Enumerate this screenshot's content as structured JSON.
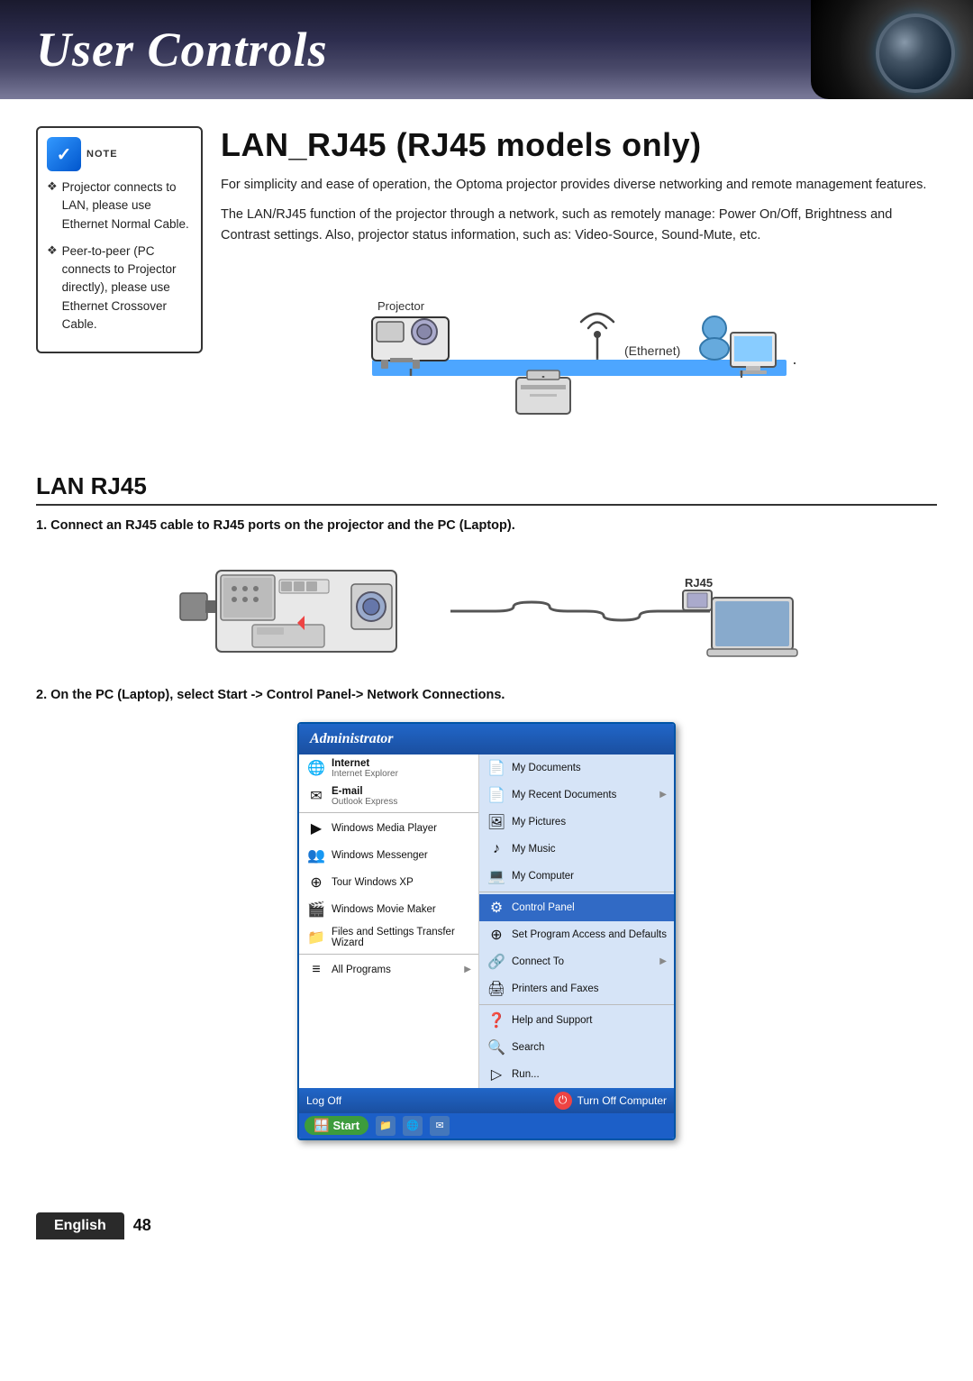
{
  "header": {
    "title": "User Controls",
    "lens_alt": "projector lens"
  },
  "page": {
    "section_title": "LAN_RJ45 (RJ45 models only)",
    "intro_para1": "For simplicity and ease of operation, the Optoma projector provides diverse networking and remote management features.",
    "intro_para2": "The LAN/RJ45 function of the projector through a network, such as remotely manage: Power On/Off, Brightness and Contrast settings. Also, projector status information, such as: Video-Source, Sound-Mute, etc.",
    "diagram_projector_label": "Projector",
    "diagram_ethernet_label": "(Ethernet)",
    "lan_subheading": "LAN  RJ45",
    "step1": "1.  Connect an RJ45 cable to RJ45 ports on the projector and the PC (Laptop).",
    "step2": "2.  On the PC (Laptop), select Start -> Control Panel-> Network Connections.",
    "note_bullets": [
      "Projector connects to LAN, please use Ethernet Normal Cable.",
      "Peer-to-peer (PC connects to Projector directly), please use Ethernet Crossover Cable."
    ]
  },
  "start_menu": {
    "header": "Administrator",
    "left_items": [
      {
        "icon": "🌐",
        "label": "Internet",
        "sub": "Internet Explorer",
        "bold": true
      },
      {
        "icon": "✉",
        "label": "E-mail",
        "sub": "Outlook Express",
        "bold": true
      },
      {
        "icon": "▶",
        "label": "Windows Media Player",
        "sub": "",
        "bold": false
      },
      {
        "icon": "👥",
        "label": "Windows Messenger",
        "sub": "",
        "bold": false
      },
      {
        "icon": "⊕",
        "label": "Tour Windows XP",
        "sub": "",
        "bold": false
      },
      {
        "icon": "🎬",
        "label": "Windows Movie Maker",
        "sub": "",
        "bold": false
      },
      {
        "icon": "📁",
        "label": "Files and Settings Transfer Wizard",
        "sub": "",
        "bold": false
      },
      {
        "icon": "≡",
        "label": "All Programs",
        "sub": "",
        "bold": false,
        "arrow": true
      }
    ],
    "right_items": [
      {
        "icon": "📄",
        "label": "My Documents",
        "sub": "",
        "arrow": false
      },
      {
        "icon": "📄",
        "label": "My Recent Documents",
        "sub": "",
        "arrow": true
      },
      {
        "icon": "🖼",
        "label": "My Pictures",
        "sub": "",
        "arrow": false
      },
      {
        "icon": "♪",
        "label": "My Music",
        "sub": "",
        "arrow": false
      },
      {
        "icon": "💻",
        "label": "My Computer",
        "sub": "",
        "arrow": false
      },
      {
        "icon": "⚙",
        "label": "Control Panel",
        "sub": "",
        "arrow": false,
        "highlighted": true
      },
      {
        "icon": "⊕",
        "label": "Set Program Access and Defaults",
        "sub": "",
        "arrow": false
      },
      {
        "icon": "🔗",
        "label": "Connect To",
        "sub": "",
        "arrow": true
      },
      {
        "icon": "🖨",
        "label": "Printers and Faxes",
        "sub": "",
        "arrow": false
      },
      {
        "icon": "❓",
        "label": "Help and Support",
        "sub": "",
        "arrow": false
      },
      {
        "icon": "🔍",
        "label": "Search",
        "sub": "",
        "arrow": false
      },
      {
        "icon": "▷",
        "label": "Run...",
        "sub": "",
        "arrow": false
      }
    ],
    "bottom_left": "Log Off",
    "bottom_right": "Turn Off Computer",
    "start_label": "Start"
  },
  "footer": {
    "language": "English",
    "page_number": "48"
  }
}
